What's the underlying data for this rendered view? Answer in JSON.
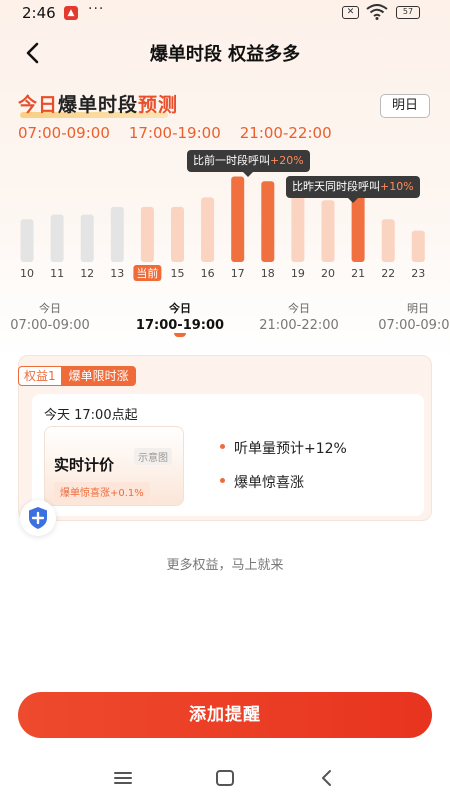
{
  "status_bar": {
    "time": "2:46",
    "dots": "···",
    "battery": "57"
  },
  "header": {
    "title": "爆单时段 权益多多"
  },
  "forecast": {
    "title_parts": [
      "今日",
      "爆单时段",
      "预测"
    ],
    "tomorrow_label": "明日",
    "time_windows": [
      "07:00-09:00",
      "17:00-19:00",
      "21:00-22:00"
    ]
  },
  "colors": {
    "accent": "#ef6b39",
    "primary_button": "#e8341f",
    "bar_gray": "#e4e4e4",
    "bar_light": "#fbd3c1",
    "bar_hot": "#f07040"
  },
  "tooltips": {
    "prev": {
      "text": "比前一时段呼叫",
      "pct": "+20%"
    },
    "yesterday": {
      "text": "比昨天同时段呼叫",
      "pct": "+10%"
    }
  },
  "chart_data": {
    "type": "bar",
    "categories": [
      "10",
      "11",
      "12",
      "13",
      "当前",
      "15",
      "16",
      "17",
      "18",
      "19",
      "20",
      "21",
      "22",
      "23"
    ],
    "values": [
      45,
      50,
      50,
      58,
      58,
      58,
      68,
      90,
      85,
      70,
      65,
      70,
      45,
      33
    ],
    "ylim": [
      0,
      100
    ],
    "xlabel": "",
    "ylabel": "",
    "highlight_categories": [
      "17",
      "18",
      "21"
    ],
    "current_label": "当前"
  },
  "day_times": [
    {
      "day": "今日",
      "range": "07:00-09:00",
      "active": false
    },
    {
      "day": "今日",
      "range": "17:00-19:00",
      "active": true
    },
    {
      "day": "今日",
      "range": "21:00-22:00",
      "active": false
    },
    {
      "day": "明日",
      "range": "07:00-09:00",
      "active": false
    }
  ],
  "benefit": {
    "tag_num": "权益1",
    "tag_name": "爆单限时涨",
    "start_text": "今天 17:00点起",
    "demo_label": "实时计价",
    "demo_hint": "示意图",
    "demo_badge": "爆单惊喜涨+0.1%",
    "bullets": [
      "听单量预计+12%",
      "爆单惊喜涨"
    ]
  },
  "more_text": "更多权益，马上就来",
  "action": {
    "add_reminder": "添加提醒"
  }
}
